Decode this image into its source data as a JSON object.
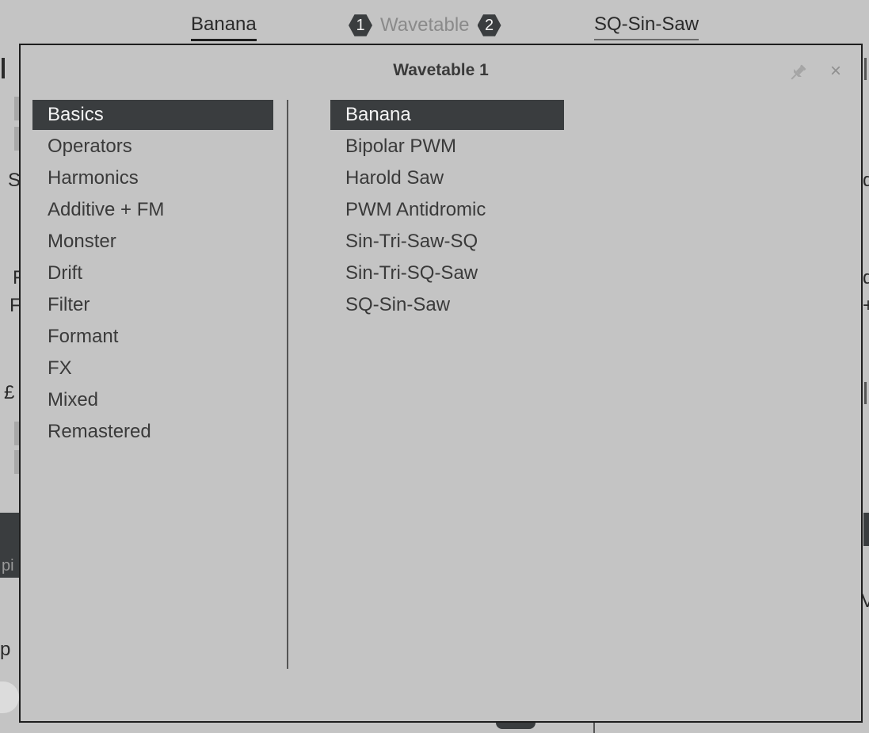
{
  "topbar": {
    "left_tab": "Banana",
    "osc1_number": "1",
    "center_label": "Wavetable",
    "osc2_number": "2",
    "right_tab": "SQ-Sin-Saw"
  },
  "background": {
    "left_fragments": [
      "S",
      "F",
      "F",
      "£",
      "pi",
      "p"
    ],
    "right_fragments": [
      "d",
      "d",
      "+",
      "V"
    ]
  },
  "popup": {
    "title": "Wavetable 1",
    "pin_icon": "pin-icon",
    "close_icon": "close-icon",
    "close_glyph": "×",
    "categories": [
      {
        "label": "Basics",
        "selected": true
      },
      {
        "label": "Operators",
        "selected": false
      },
      {
        "label": "Harmonics",
        "selected": false
      },
      {
        "label": "Additive + FM",
        "selected": false
      },
      {
        "label": "Monster",
        "selected": false
      },
      {
        "label": "Drift",
        "selected": false
      },
      {
        "label": "Filter",
        "selected": false
      },
      {
        "label": "Formant",
        "selected": false
      },
      {
        "label": "FX",
        "selected": false
      },
      {
        "label": "Mixed",
        "selected": false
      },
      {
        "label": "Remastered",
        "selected": false
      }
    ],
    "presets": [
      {
        "label": "Banana",
        "selected": true
      },
      {
        "label": "Bipolar PWM",
        "selected": false
      },
      {
        "label": "Harold Saw",
        "selected": false
      },
      {
        "label": "PWM Antidromic",
        "selected": false
      },
      {
        "label": "Sin-Tri-Saw-SQ",
        "selected": false
      },
      {
        "label": "Sin-Tri-SQ-Saw",
        "selected": false
      },
      {
        "label": "SQ-Sin-Saw",
        "selected": false
      }
    ]
  },
  "colors": {
    "background": "#c4c4c4",
    "selection": "#3a3d3f",
    "text": "#3a3a3a",
    "selected_text": "#f4f4f4"
  }
}
